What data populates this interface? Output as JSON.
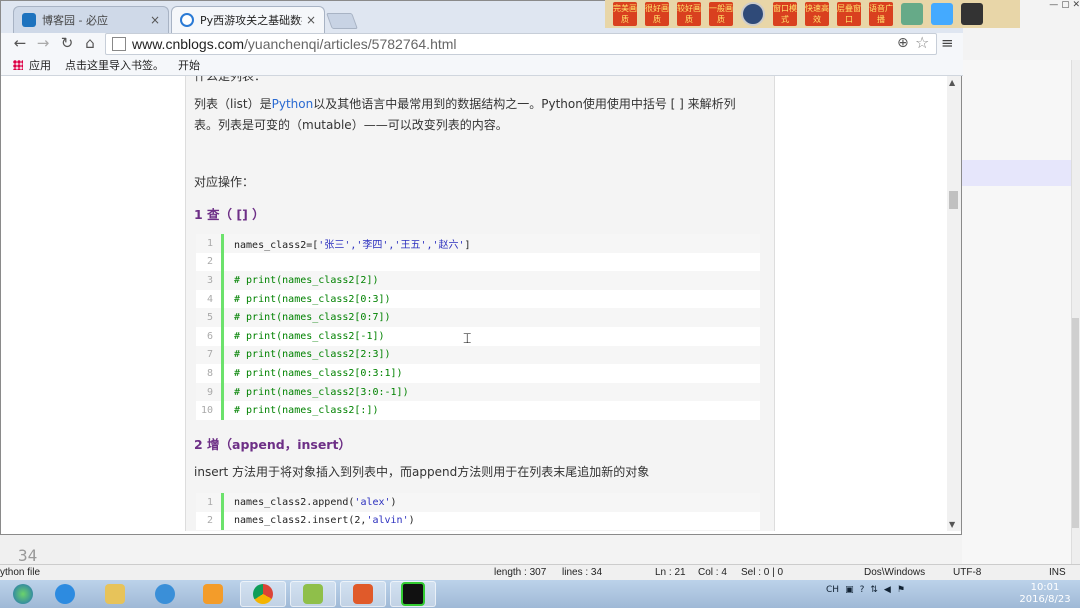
{
  "browser": {
    "tabs": [
      {
        "title": "博客园 - 必应",
        "close": "×"
      },
      {
        "title": "Py西游攻关之基础数据类",
        "close": "×"
      }
    ],
    "url_host": "www.cnblogs.com",
    "url_path": "/yuanchenqi/articles/5782764.html",
    "bookmarks": [
      "应用",
      "点击这里导入书签。",
      "开始"
    ]
  },
  "quickbar": [
    "完美画质",
    "很好画质",
    "较好画质",
    "一般画质",
    "窗口模式",
    "快速高效",
    "层叠窗口",
    "语音广播"
  ],
  "article": {
    "cut_heading": "什么是列表：",
    "intro_pre": "列表（list）是",
    "intro_link": "Python",
    "intro_post": "以及其他语言中最常用到的数据结构之一。Python使用使用中括号 [ ] 来解析列表。列表是可变的（mutable）——可以改变列表的内容。",
    "ops_label": "对应操作：",
    "section1": "1 查（ [] ）",
    "code1": [
      {
        "n": "1",
        "pre": "names_class2=[",
        "str": "'张三','李四','王五','赵六'",
        "post": "]",
        "comment": false
      },
      {
        "n": "2",
        "pre": "",
        "str": "",
        "post": "",
        "comment": false
      },
      {
        "n": "3",
        "pre": "# print(names_class2[2])",
        "str": "",
        "post": "",
        "comment": true
      },
      {
        "n": "4",
        "pre": "# print(names_class2[0:3])",
        "str": "",
        "post": "",
        "comment": true
      },
      {
        "n": "5",
        "pre": "# print(names_class2[0:7])",
        "str": "",
        "post": "",
        "comment": true
      },
      {
        "n": "6",
        "pre": "# print(names_class2[-1])",
        "str": "",
        "post": "",
        "comment": true
      },
      {
        "n": "7",
        "pre": "# print(names_class2[2:3])",
        "str": "",
        "post": "",
        "comment": true
      },
      {
        "n": "8",
        "pre": "# print(names_class2[0:3:1])",
        "str": "",
        "post": "",
        "comment": true
      },
      {
        "n": "9",
        "pre": "# print(names_class2[3:0:-1])",
        "str": "",
        "post": "",
        "comment": true
      },
      {
        "n": "10",
        "pre": "# print(names_class2[:])",
        "str": "",
        "post": "",
        "comment": true
      }
    ],
    "section2": "2 增（append，insert）",
    "insert_desc": "insert 方法用于将对象插入到列表中，而append方法则用于在列表末尾追加新的对象",
    "code2": [
      {
        "n": "1",
        "pre": "names_class2.append(",
        "str": "'alex'",
        "post": ")",
        "comment": false
      },
      {
        "n": "2",
        "pre": "names_class2.insert(2,",
        "str": "'alvin'",
        "post": ")",
        "comment": false
      }
    ]
  },
  "background_editor": {
    "line_number": "34"
  },
  "statusbar": {
    "file_type": "ython file",
    "length": "length : 307",
    "lines": "lines : 34",
    "ln": "Ln : 21",
    "col": "Col : 4",
    "sel": "Sel : 0 | 0",
    "eol": "Dos\\Windows",
    "encoding": "UTF-8",
    "mode": "INS"
  },
  "tray": {
    "lang": "CH",
    "time": "10:01",
    "date": "2016/8/23"
  }
}
